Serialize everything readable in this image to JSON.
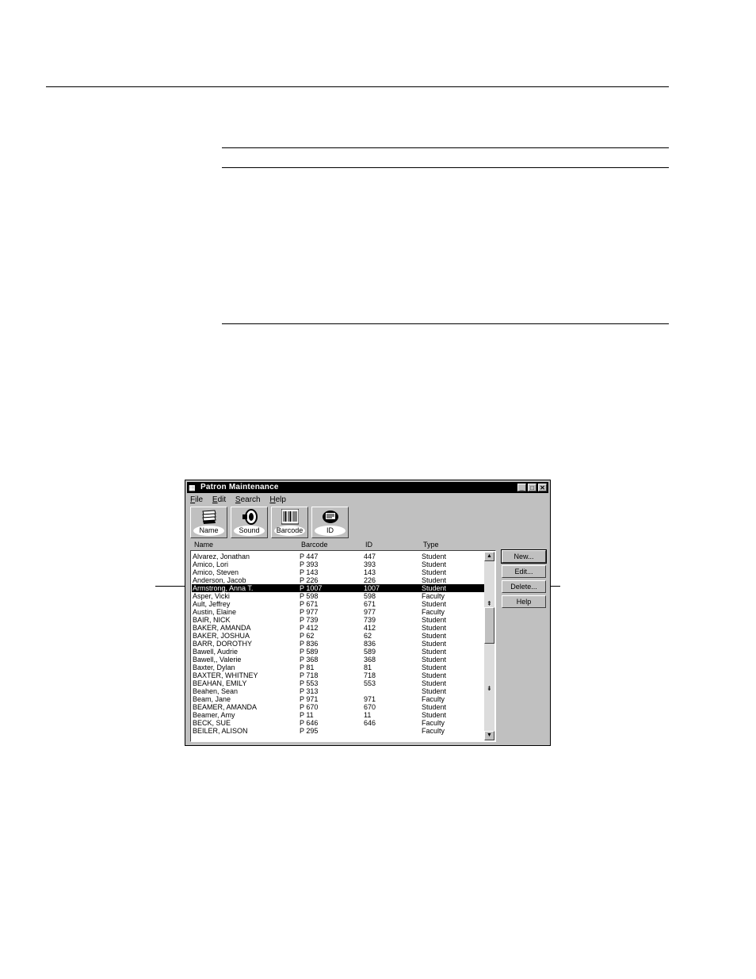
{
  "window": {
    "title": "Patron Maintenance",
    "controls": {
      "minimize": "_",
      "maximize": "□",
      "close": "✕"
    }
  },
  "menu": [
    {
      "key": "F",
      "rest": "ile"
    },
    {
      "key": "E",
      "rest": "dit"
    },
    {
      "key": "S",
      "rest": "earch"
    },
    {
      "key": "H",
      "rest": "elp"
    }
  ],
  "toolbar": {
    "name": "Name",
    "sound": "Sound",
    "barcode": "Barcode",
    "id": "ID"
  },
  "columns": {
    "name": "Name",
    "barcode": "Barcode",
    "id": "ID",
    "type": "Type"
  },
  "patrons": [
    [
      "Alvarez, Jonathan",
      "P 447",
      "447",
      "Student"
    ],
    [
      "Amico, Lori",
      "P 393",
      "393",
      "Student"
    ],
    [
      "Amico, Steven",
      "P 143",
      "143",
      "Student"
    ],
    [
      "Anderson, Jacob",
      "P 226",
      "226",
      "Student"
    ],
    [
      "Armstrong, Anna T.",
      "P 1007",
      "1007",
      "Student"
    ],
    [
      "Asper, Vicki",
      "P 598",
      "598",
      "Faculty"
    ],
    [
      "Ault, Jeffrey",
      "P 671",
      "671",
      "Student"
    ],
    [
      "Austin, Elaine",
      "P 977",
      "977",
      "Faculty"
    ],
    [
      "BAIR, NICK",
      "P 739",
      "739",
      "Student"
    ],
    [
      "BAKER, AMANDA",
      "P 412",
      "412",
      "Student"
    ],
    [
      "BAKER, JOSHUA",
      "P 62",
      "62",
      "Student"
    ],
    [
      "BARR, DOROTHY",
      "P 836",
      "836",
      "Student"
    ],
    [
      "Bawell, Audrie",
      "P 589",
      "589",
      "Student"
    ],
    [
      "Bawell,, Valerie",
      "P 368",
      "368",
      "Student"
    ],
    [
      "Baxter, Dylan",
      "P 81",
      "81",
      "Student"
    ],
    [
      "BAXTER, WHITNEY",
      "P 718",
      "718",
      "Student"
    ],
    [
      "BEAHAN, EMILY",
      "P 553",
      "553",
      "Student"
    ],
    [
      "Beahen, Sean",
      "P 313",
      "",
      "Student"
    ],
    [
      "Beam, Jane",
      "P 971",
      "971",
      "Faculty"
    ],
    [
      "BEAMER, AMANDA",
      "P 670",
      "670",
      "Student"
    ],
    [
      "Beamer, Amy",
      "P 11",
      "11",
      "Student"
    ],
    [
      "BECK, SUE",
      "P 646",
      "646",
      "Faculty"
    ],
    [
      "BEILER, ALISON",
      "P 295",
      "",
      "Faculty"
    ]
  ],
  "selected_index": 4,
  "buttons": {
    "new": "New...",
    "edit": "Edit...",
    "delete": "Delete...",
    "help": "Help"
  }
}
